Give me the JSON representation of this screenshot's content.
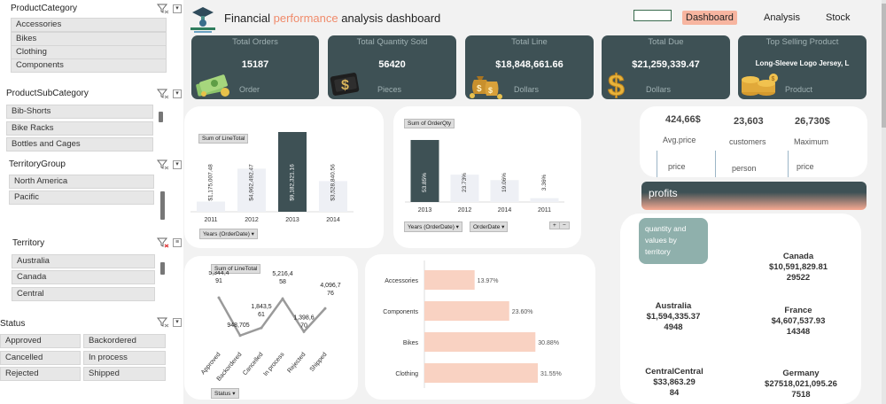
{
  "slicers": {
    "product_category": {
      "title": "ProductCategory",
      "items": [
        "Accessories",
        "Bikes",
        "Clothing",
        "Components"
      ]
    },
    "product_subcategory": {
      "title": "ProductSubCategory",
      "items": [
        "Bib-Shorts",
        "Bike Racks",
        "Bottles and Cages"
      ]
    },
    "territory_group": {
      "title": "TerritoryGroup",
      "items": [
        "North America",
        "Pacific"
      ]
    },
    "territory": {
      "title": "Territory",
      "items": [
        "Australia",
        "Canada",
        "Central"
      ]
    },
    "status": {
      "title": "Status",
      "items": [
        "Approved",
        "Backordered",
        "Cancelled",
        "In process",
        "Rejected",
        "Shipped"
      ]
    }
  },
  "header": {
    "title_start": "Financial ",
    "title_accent": "performance",
    "title_end": " analysis dashboard",
    "nav": [
      "Dashboard",
      "Analysis",
      "Stock"
    ],
    "active_nav": "Dashboard"
  },
  "kpis": [
    {
      "label": "Total Orders",
      "value": "15187",
      "unit": "Order",
      "icon": "money-stack-icon"
    },
    {
      "label": "Total Quantity Sold",
      "value": "56420",
      "unit": "Pieces",
      "icon": "wallet-dollar-icon"
    },
    {
      "label": "Total Line",
      "value": "$18,848,661.66",
      "unit": "Dollars",
      "icon": "money-bags-icon"
    },
    {
      "label": "Total Due",
      "value": "$21,259,339.47",
      "unit": "Dollars",
      "icon": "dollar-sign-icon"
    },
    {
      "label": "Top Selling Product",
      "value": "Long-Sleeve Logo Jersey, L",
      "unit": "Product",
      "icon": "coin-stack-icon"
    }
  ],
  "stats": {
    "avg_price": {
      "value": "424,66$",
      "label": "Avg.price",
      "sub": "price"
    },
    "customers": {
      "value": "23,603",
      "label": "customers",
      "sub": "person"
    },
    "maximum": {
      "value": "26,730$",
      "label": "Maximum",
      "sub": "price"
    }
  },
  "profits_label": "profits",
  "territory_tag": "quantity and values by territory",
  "territories": [
    {
      "name": "Canada",
      "value": "$10,591,829.81",
      "qty": "29522"
    },
    {
      "name": "Australia",
      "value": "$1,594,335.37",
      "qty": "4948"
    },
    {
      "name": "France",
      "value": "$4,607,537.93",
      "qty": "14348"
    },
    {
      "name": "CentralCentral",
      "value": "$33,863.29",
      "qty": "84"
    },
    {
      "name": "Germany",
      "value": "$27518,021,095.26",
      "qty": "7518"
    }
  ],
  "pivot_buttons": {
    "years_orderdate": "Years (OrderDate)",
    "orderdate": "OrderDate",
    "status": "Status"
  },
  "chart_data": [
    {
      "type": "bar",
      "title": "Sum of LineTotal",
      "categories": [
        "2011",
        "2012",
        "2013",
        "2014"
      ],
      "values": [
        1175007.48,
        4962492.47,
        9182321.16,
        3528840.56
      ],
      "labels": [
        "$1,175,007.48",
        "$4,962,492.47",
        "$9,182,321.16",
        "$3,528,840.56"
      ],
      "highlight_index": 2,
      "ylim": [
        0,
        9182321.16
      ]
    },
    {
      "type": "bar",
      "title": "Sum of OrderQty",
      "categories": [
        "2013",
        "2012",
        "2014",
        "2011"
      ],
      "values": [
        53.85,
        23.73,
        19.06,
        3.36
      ],
      "labels": [
        "53.85%",
        "23.73%",
        "19.06%",
        "3.36%"
      ],
      "highlight_index": 0,
      "ylim": [
        0,
        53.85
      ]
    },
    {
      "type": "line",
      "title": "Sum of LineTotal",
      "categories": [
        "Approved",
        "Backordered",
        "Cancelled",
        "In process",
        "Rejected",
        "Shipped"
      ],
      "values": [
        5344491,
        948705,
        1843561,
        5216458,
        1398670,
        4096776
      ],
      "labels": [
        "5,344,4\n91",
        "948,705",
        "1,843,5\n61",
        "5,216,4\n58",
        "1,398,6\n70",
        "4,096,7\n76"
      ],
      "ylim": [
        0,
        5344491
      ]
    },
    {
      "type": "bar",
      "orientation": "horizontal",
      "categories": [
        "Accessories",
        "Components",
        "Bikes",
        "Clothing"
      ],
      "values": [
        13.97,
        23.6,
        30.88,
        31.55
      ],
      "labels": [
        "13.97%",
        "23.60%",
        "30.88%",
        "31.55%"
      ],
      "xlim": [
        0,
        31.55
      ]
    }
  ],
  "colors": {
    "card_dark": "#3e5155",
    "accent_salmon": "#f7b5a0",
    "bar_highlight": "#3e5155",
    "bar_light": "#eef0f5",
    "hbar": "#f9d2c2"
  }
}
